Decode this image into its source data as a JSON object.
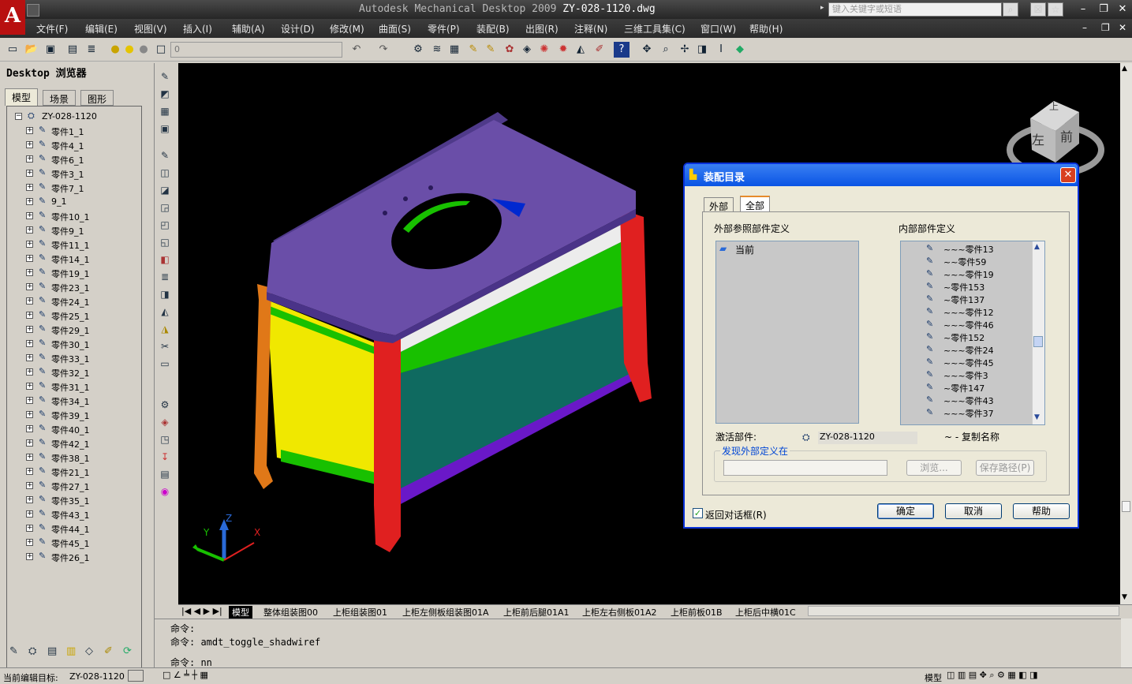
{
  "title": {
    "app": "Autodesk Mechanical Desktop 2009",
    "file": "ZY-028-1120.dwg"
  },
  "search_placeholder": "键入关键字或短语",
  "menu": [
    "文件(F)",
    "编辑(E)",
    "视图(V)",
    "插入(I)",
    "辅助(A)",
    "设计(D)",
    "修改(M)",
    "曲面(S)",
    "零件(P)",
    "装配(B)",
    "出图(R)",
    "注释(N)",
    "三维工具集(C)",
    "窗口(W)",
    "帮助(H)"
  ],
  "layer_value": "0",
  "browser": {
    "title": "Desktop 浏览器",
    "tabs": [
      "模型",
      "场景",
      "图形"
    ],
    "root": "ZY-028-1120",
    "items": [
      "零件1_1",
      "零件4_1",
      "零件6_1",
      "零件3_1",
      "零件7_1",
      "9_1",
      "零件10_1",
      "零件9_1",
      "零件11_1",
      "零件14_1",
      "零件19_1",
      "零件23_1",
      "零件24_1",
      "零件25_1",
      "零件29_1",
      "零件30_1",
      "零件33_1",
      "零件32_1",
      "零件31_1",
      "零件34_1",
      "零件39_1",
      "零件40_1",
      "零件42_1",
      "零件38_1",
      "零件21_1",
      "零件27_1",
      "零件35_1",
      "零件43_1",
      "零件44_1",
      "零件45_1",
      "零件26_1"
    ]
  },
  "viewcube": {
    "top": "上",
    "left": "左",
    "front": "前"
  },
  "axes": {
    "x": "X",
    "y": "Y",
    "z": "Z"
  },
  "dialog": {
    "title": "装配目录",
    "tabs": [
      "外部",
      "全部"
    ],
    "external_label": "外部参照部件定义",
    "internal_label": "内部部件定义",
    "external_items": [
      "当前"
    ],
    "internal_items": [
      "~~~零件13",
      "~~零件59",
      "~~~零件19",
      "~零件153",
      "~零件137",
      "~~~零件12",
      "~~~零件46",
      "~零件152",
      "~~~零件24",
      "~~~零件45",
      "~~~零件3",
      "~零件147",
      "~~~零件43",
      "~~~零件37"
    ],
    "active_label": "激活部件:",
    "active_value": "ZY-028-1120",
    "copy_name": "~ - 复制名称",
    "discover_label": "发现外部定义在",
    "browse": "浏览...",
    "save_path": "保存路径(P)",
    "return_checkbox": "返回对话框(R)",
    "return_checked": true,
    "ok": "确定",
    "cancel": "取消",
    "help": "帮助"
  },
  "layout_tabs": [
    "模型",
    "整体组装图00",
    "上柜组装图01",
    "上柜左侧板组装图01A",
    "上柜前后腿01A1",
    "上柜左右侧板01A2",
    "上柜前板01B",
    "上柜后中横01C"
  ],
  "command_lines": [
    "命令:",
    "命令: amdt_toggle_shadwiref",
    "命令: nn"
  ],
  "status": {
    "target_label": "当前编辑目标:",
    "target_value": "ZY-028-1120",
    "model": "模型"
  },
  "colors": {
    "purple": "#6a4ea8",
    "yellow": "#f0e800",
    "green": "#18c000",
    "teal": "#0f6a60",
    "red": "#e02020",
    "orange": "#e07818"
  }
}
